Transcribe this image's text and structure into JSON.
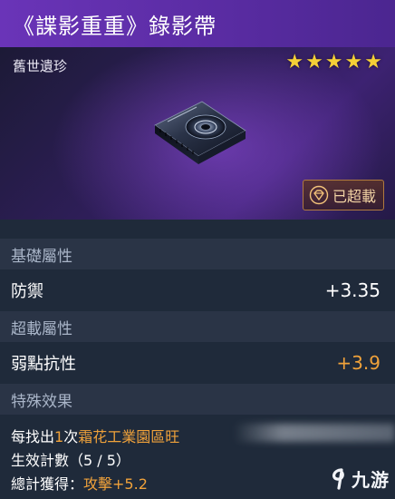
{
  "header": {
    "title": "《諜影重重》錄影帶"
  },
  "item": {
    "rarity": "舊世遺珍",
    "stars": 5,
    "star_color": "#f5cf37",
    "overload_badge": "已超載"
  },
  "sections": {
    "base": "基礎屬性",
    "overload": "超載屬性",
    "special": "特殊效果"
  },
  "stats": {
    "defense": {
      "name": "防禦",
      "value": "+3.35"
    },
    "weakpoint": {
      "name": "弱點抗性",
      "value": "+3.9",
      "color": "#f0a23a"
    }
  },
  "effect": {
    "line1_prefix": "每找出",
    "line1_count": "1",
    "line1_unit": "次",
    "line1_place": "霜花工業園區",
    "line1_cut": "旺",
    "line2": "生效計數（5 / 5）",
    "line3_prefix": "總計獲得：",
    "line3_value": "攻擊+5.2"
  },
  "watermark": {
    "text": "九游"
  }
}
